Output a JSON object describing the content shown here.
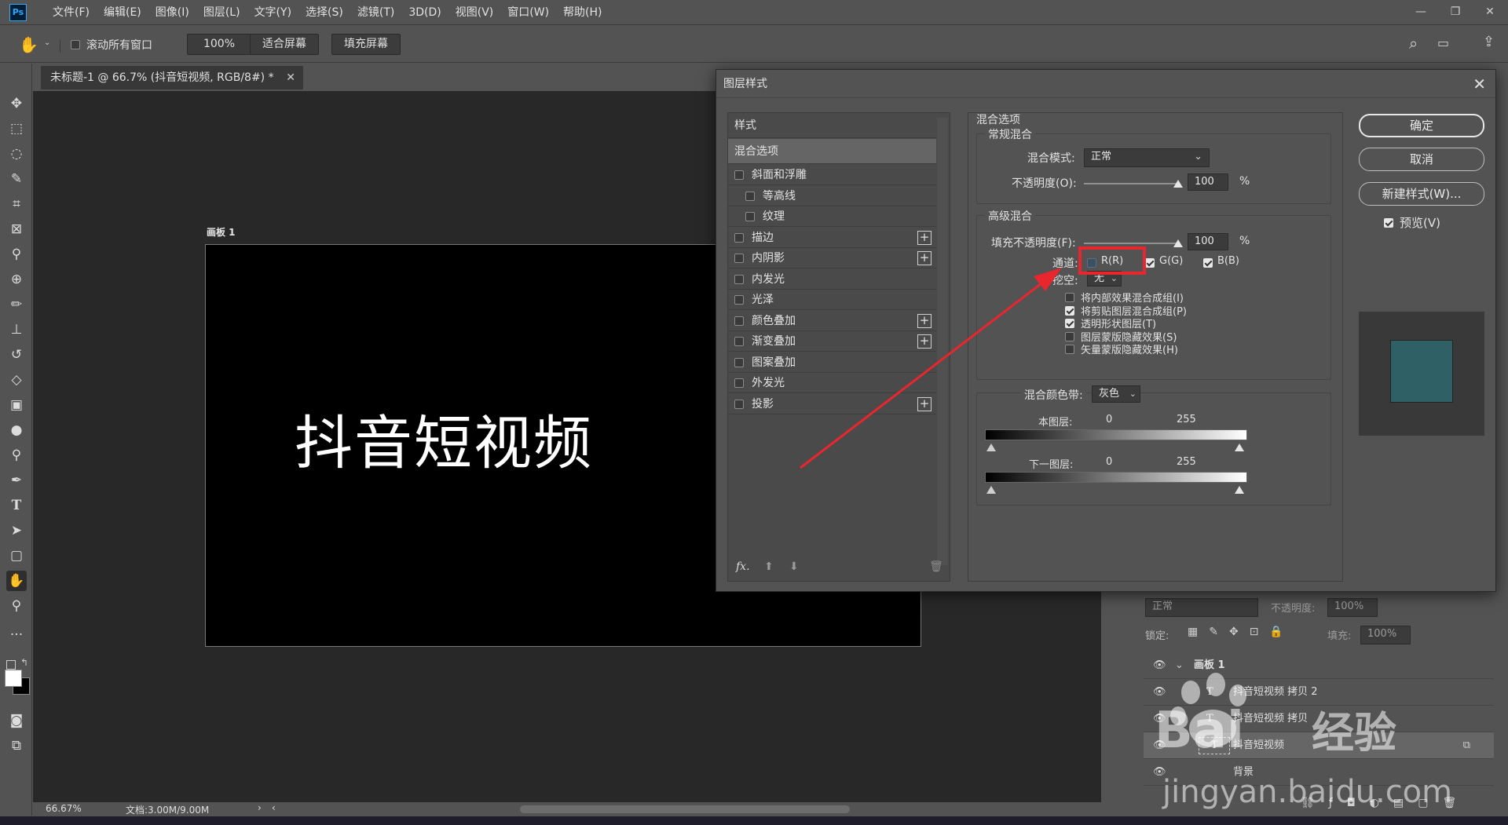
{
  "menubar": {
    "logo": "Ps",
    "items": [
      "文件(F)",
      "编辑(E)",
      "图像(I)",
      "图层(L)",
      "文字(Y)",
      "选择(S)",
      "滤镜(T)",
      "3D(D)",
      "视图(V)",
      "窗口(W)",
      "帮助(H)"
    ]
  },
  "options_bar": {
    "scroll_all": "滚动所有窗口",
    "zoom": "100%",
    "fit_screen": "适合屏幕",
    "fill_screen": "填充屏幕"
  },
  "document": {
    "tab_title": "未标题-1 @ 66.7% (抖音短视频, RGB/8#) *",
    "artboard_label": "画板 1",
    "artboard_text": "抖音短视频",
    "status_zoom": "66.67%",
    "status_doc": "文档:3.00M/9.00M"
  },
  "dialog": {
    "title": "图层样式",
    "styles_header": "样式",
    "blend_options": "混合选项",
    "effects": [
      {
        "label": "斜面和浮雕",
        "indent": false,
        "plus": false
      },
      {
        "label": "等高线",
        "indent": true,
        "plus": false
      },
      {
        "label": "纹理",
        "indent": true,
        "plus": false
      },
      {
        "label": "描边",
        "indent": false,
        "plus": true
      },
      {
        "label": "内阴影",
        "indent": false,
        "plus": true
      },
      {
        "label": "内发光",
        "indent": false,
        "plus": false
      },
      {
        "label": "光泽",
        "indent": false,
        "plus": false
      },
      {
        "label": "颜色叠加",
        "indent": false,
        "plus": true
      },
      {
        "label": "渐变叠加",
        "indent": false,
        "plus": true
      },
      {
        "label": "图案叠加",
        "indent": false,
        "plus": false
      },
      {
        "label": "外发光",
        "indent": false,
        "plus": false
      },
      {
        "label": "投影",
        "indent": false,
        "plus": true
      }
    ],
    "fx_label": "fx.",
    "section_title": "混合选项",
    "general_blend": "常规混合",
    "blend_mode_label": "混合模式:",
    "blend_mode_value": "正常",
    "opacity_label": "不透明度(O):",
    "opacity_value": "100",
    "percent": "%",
    "advanced_blend": "高级混合",
    "fill_opacity_label": "填充不透明度(F):",
    "fill_opacity_value": "100",
    "channels_label": "通道:",
    "channel_r": "R(R)",
    "channel_g": "G(G)",
    "channel_b": "B(B)",
    "knockout_label": "挖空:",
    "knockout_value": "无",
    "adv_options": [
      {
        "label": "将内部效果混合成组(I)",
        "checked": false
      },
      {
        "label": "将剪贴图层混合成组(P)",
        "checked": true
      },
      {
        "label": "透明形状图层(T)",
        "checked": true
      },
      {
        "label": "图层蒙版隐藏效果(S)",
        "checked": false
      },
      {
        "label": "矢量蒙版隐藏效果(H)",
        "checked": false
      }
    ],
    "blend_if_label": "混合颜色带:",
    "blend_if_value": "灰色",
    "this_layer": "本图层:",
    "underlying": "下一图层:",
    "range_low": "0",
    "range_high": "255",
    "ok": "确定",
    "cancel": "取消",
    "new_style": "新建样式(W)...",
    "preview": "预览(V)",
    "preview_color": "#2e6065"
  },
  "layers": {
    "mode": "正常",
    "opacity_label": "不透明度:",
    "opacity": "100%",
    "lock_label": "锁定:",
    "fill_label": "填充:",
    "fill": "100%",
    "rows": [
      "画板 1",
      "抖音短视频 拷贝 2",
      "抖音短视频 拷贝",
      "抖音短视频",
      "背景"
    ]
  },
  "annotation": {
    "highlight_color": "#e8262e"
  },
  "watermark": {
    "brand": "Bai",
    "brand2": "经验",
    "url": "jingyan.baidu.com"
  }
}
